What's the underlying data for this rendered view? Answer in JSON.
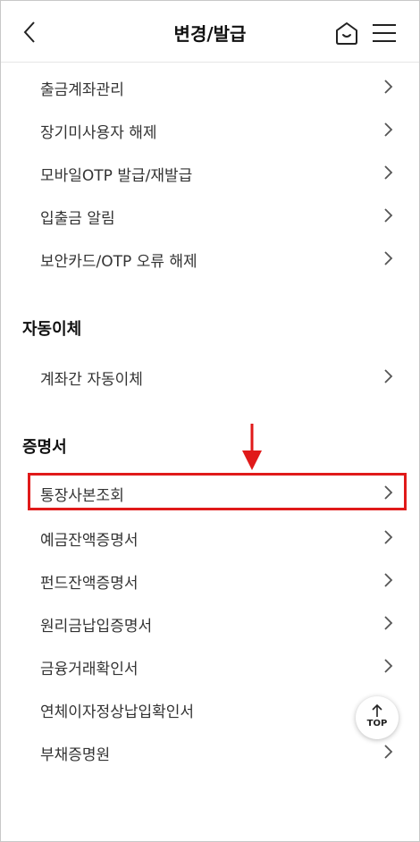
{
  "header": {
    "title": "변경/발급",
    "back_icon": "chevron-left-icon",
    "home_icon": "home-icon",
    "menu_icon": "hamburger-menu-icon"
  },
  "top_list": [
    {
      "label": "출금계좌관리"
    },
    {
      "label": "장기미사용자 해제"
    },
    {
      "label": "모바일OTP 발급/재발급"
    },
    {
      "label": "입출금 알림"
    },
    {
      "label": "보안카드/OTP 오류 해제"
    }
  ],
  "auto_transfer": {
    "title": "자동이체",
    "items": [
      {
        "label": "계좌간 자동이체"
      }
    ]
  },
  "certificates": {
    "title": "증명서",
    "items": [
      {
        "label": "통장사본조회"
      },
      {
        "label": "예금잔액증명서"
      },
      {
        "label": "펀드잔액증명서"
      },
      {
        "label": "원리금납입증명서"
      },
      {
        "label": "금융거래확인서"
      },
      {
        "label": "연체이자정상납입확인서"
      },
      {
        "label": "부채증명원"
      }
    ]
  },
  "top_button": {
    "label": "TOP"
  },
  "colors": {
    "highlight": "#e01a1a",
    "text": "#333333",
    "chevron": "#555555"
  }
}
